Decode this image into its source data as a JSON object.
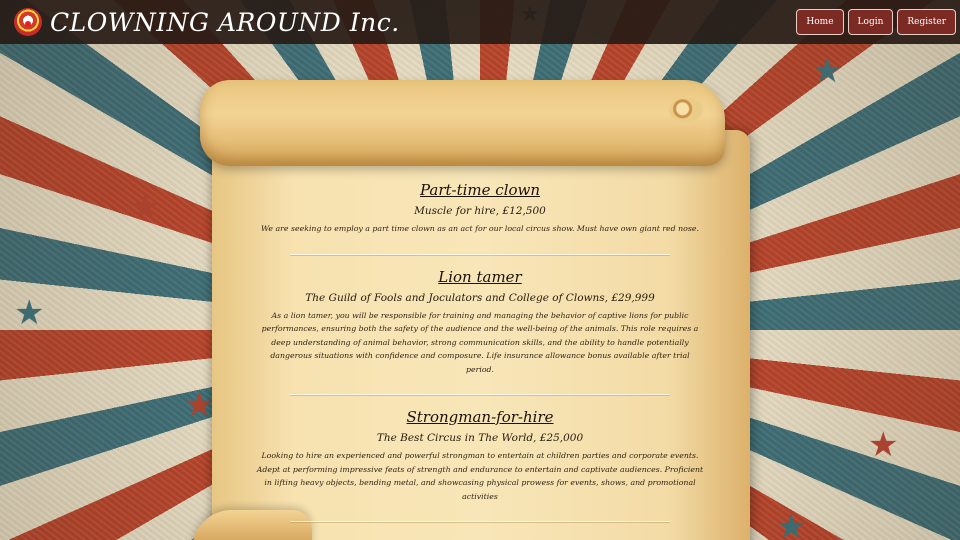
{
  "header": {
    "site_title": "CLOWNING AROUND Inc.",
    "logo_icon": "clown-logo-icon"
  },
  "nav": {
    "home": "Home",
    "login": "Login",
    "register": "Register"
  },
  "jobs": [
    {
      "title": "Part-time clown",
      "subtitle": "Muscle for hire, £12,500",
      "description": "We are seeking to employ a part time clown as an act for our local circus show. Must have own giant red nose."
    },
    {
      "title": "Lion tamer",
      "subtitle": "The Guild of Fools and Joculators and College of Clowns, £29,999",
      "description": "As a lion tamer, you will be responsible for training and managing the behavior of captive lions for public performances, ensuring both the safety of the audience and the well-being of the animals. This role requires a deep understanding of animal behavior, strong communication skills, and the ability to handle potentially dangerous situations with confidence and composure. Life insurance allowance bonus available after trial period."
    },
    {
      "title": "Strongman-for-hire",
      "subtitle": "The Best Circus in The World, £25,000",
      "description": "Looking to hire an experienced and powerful strongman to entertain at children parties and corporate events. Adept at performing impressive feats of strength and endurance to entertain and captivate audiences. Proficient in lifting heavy objects, bending metal, and showcasing physical prowess for events, shows, and promotional activities"
    }
  ],
  "colors": {
    "header_bg": "#281c16",
    "nav_button": "#7c2a24",
    "stripe_red": "#b8452c",
    "stripe_teal": "#3f6f77",
    "parchment": "#f8e6b8"
  }
}
